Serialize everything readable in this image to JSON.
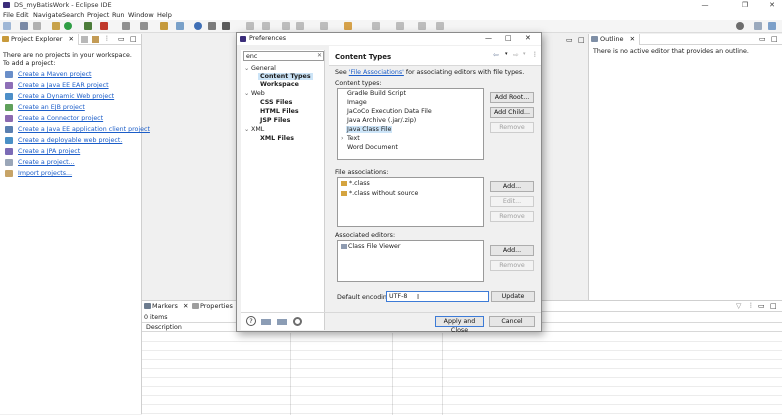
{
  "window": {
    "title": "DS_myBatisWork - Eclipse IDE",
    "min": "—",
    "max": "❐",
    "close": "✕"
  },
  "menu": [
    "File",
    "Edit",
    "Navigate",
    "Search",
    "Project",
    "Run",
    "Window",
    "Help"
  ],
  "project_explorer": {
    "tab": "Project Explorer",
    "message": [
      "There are no projects in your workspace.",
      "To add a project:"
    ],
    "links": [
      "Create a Maven project",
      "Create a Java EE EAR project",
      "Create a Dynamic Web project",
      "Create an EJB project",
      "Create a Connector project",
      "Create a Java EE application client project",
      "Create a deployable web project.",
      "Create a JPA project",
      "Create a project...",
      "Import projects..."
    ]
  },
  "outline": {
    "tab": "Outline",
    "message": "There is no active editor that provides an outline."
  },
  "bottom": {
    "tab_markers": "Markers",
    "tab_properties": "Properties",
    "items": "0 items",
    "col_description": "Description"
  },
  "dialog": {
    "title": "Preferences",
    "filter": "enc",
    "tree": [
      {
        "label": "General",
        "toggle": "⌄",
        "children": [
          "Content Types",
          "Workspace"
        ]
      },
      {
        "label": "Web",
        "toggle": "⌄",
        "children": [
          "CSS Files",
          "HTML Files",
          "JSP Files"
        ]
      },
      {
        "label": "XML",
        "toggle": "⌄",
        "children": [
          "XML Files"
        ]
      }
    ],
    "page_title": "Content Types",
    "description_prefix": "See ",
    "description_link": "'File Associations'",
    "description_suffix": " for associating editors with file types.",
    "content_types_label": "Content types:",
    "content_types": [
      "Gradle Build Script",
      "Image",
      "JaCoCo Execution Data File",
      "Java Archive (.jar/.zip)",
      "Java Class File",
      "Text",
      "Word Document"
    ],
    "selected_content_type": "Java Class File",
    "text_toggle": "›",
    "btn_add_root": "Add Root...",
    "btn_add_child": "Add Child...",
    "btn_remove": "Remove",
    "file_assoc_label": "File associations:",
    "file_assocs": [
      "*.class",
      "*.class without source"
    ],
    "btn_add": "Add...",
    "btn_edit": "Edit...",
    "assoc_editors_label": "Associated editors:",
    "assoc_editors": [
      "Class File Viewer"
    ],
    "default_encoding_label": "Default encoding:",
    "default_encoding_value": "UTF-8",
    "btn_update": "Update",
    "btn_apply_close": "Apply and Close",
    "btn_cancel": "Cancel",
    "help_glyph": "?"
  },
  "colors": {
    "accent": "#3d7bd6",
    "link": "#1b5dc8",
    "selection": "#cce4f7"
  }
}
